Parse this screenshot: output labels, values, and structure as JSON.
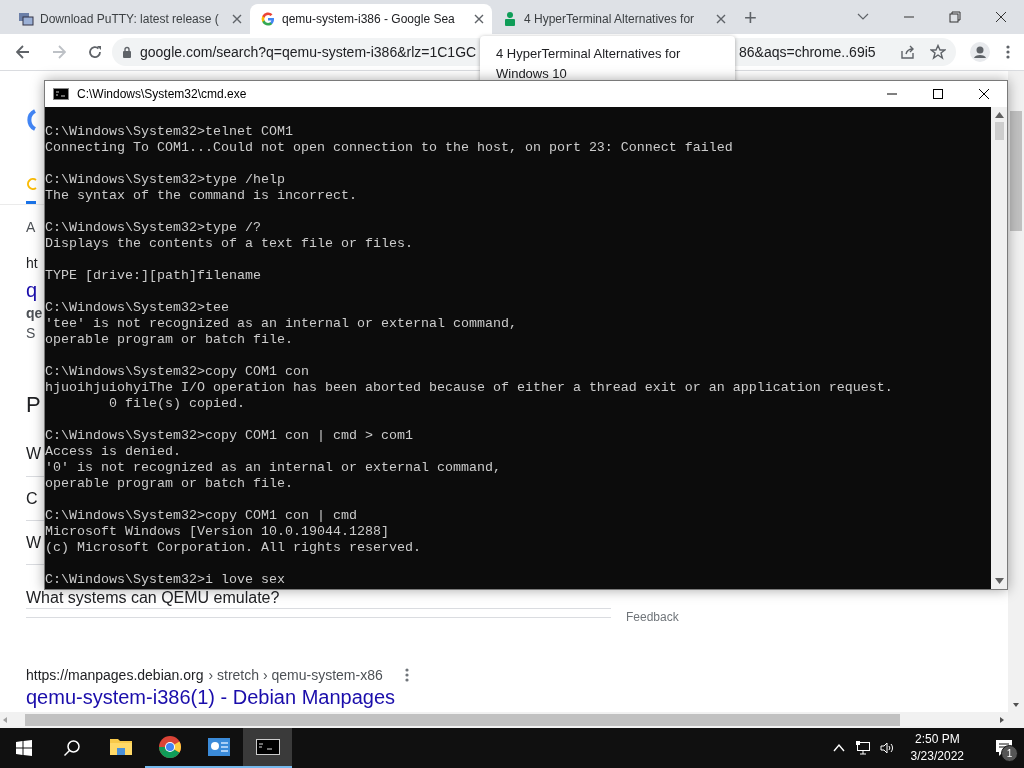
{
  "browser": {
    "tabs": [
      {
        "title": "Download PuTTY: latest release (",
        "kind": "putty",
        "selected": false
      },
      {
        "title": "qemu-system-i386 - Google Sea",
        "kind": "google",
        "selected": true
      },
      {
        "title": "4 HyperTerminal Alternatives for",
        "kind": "person",
        "selected": false
      }
    ],
    "new_tab": "+",
    "address": {
      "url_start": "google.com/search?q=qemu-system-i386&rlz=1C1GC",
      "url_end": "86&aqs=chrome..69i5"
    },
    "tooltip": {
      "lines": [
        "4 HyperTerminal Alternatives for",
        "Windows 10"
      ]
    },
    "page": {
      "results": [
        {
          "kind": "snippet",
          "text": "A"
        },
        {
          "kind": "url",
          "text": "ht"
        },
        {
          "kind": "title",
          "text": "q"
        },
        {
          "kind": "bold",
          "text": "qe"
        },
        {
          "kind": "snippet",
          "text": "S"
        },
        {
          "kind": "heading",
          "text": "P"
        }
      ],
      "questions": [
        "W",
        "C",
        "W",
        "What systems can QEMU emulate?"
      ],
      "feedback": "Feedback",
      "result": {
        "url": "https://manpages.debian.org",
        "path": "› stretch › qemu-system-x86",
        "title": "qemu-system-i386(1) - Debian Manpages"
      }
    }
  },
  "cmd_window": {
    "title": "C:\\Windows\\System32\\cmd.exe",
    "blocks": [
      [
        "C:\\Windows\\System32>telnet COM1",
        "Connecting To COM1...Could not open connection to the host, on port 23: Connect failed"
      ],
      [
        "C:\\Windows\\System32>type /help",
        "The syntax of the command is incorrect."
      ],
      [
        "C:\\Windows\\System32>type /?",
        "Displays the contents of a text file or files."
      ],
      [
        "TYPE [drive:][path]filename"
      ],
      [
        "C:\\Windows\\System32>tee",
        "'tee' is not recognized as an internal or external command,",
        "operable program or batch file."
      ],
      [
        "C:\\Windows\\System32>copy COM1 con",
        "hjuoihjuiohyiThe I/O operation has been aborted because of either a thread exit or an application request.",
        "        0 file(s) copied."
      ],
      [
        "C:\\Windows\\System32>copy COM1 con | cmd > com1",
        "Access is denied.",
        "'0' is not recognized as an internal or external command,",
        "operable program or batch file."
      ],
      [
        "C:\\Windows\\System32>copy COM1 con | cmd",
        "Microsoft Windows [Version 10.0.19044.1288]",
        "(c) Microsoft Corporation. All rights reserved."
      ],
      [
        "C:\\Windows\\System32>i love sex"
      ]
    ]
  },
  "taskbar": {
    "apps": [
      {
        "kind": "explorer",
        "running": false,
        "selected": false
      },
      {
        "kind": "chrome",
        "running": true,
        "selected": false
      },
      {
        "kind": "control",
        "running": true,
        "selected": false
      },
      {
        "kind": "cmd",
        "running": true,
        "selected": true
      }
    ],
    "clock": {
      "time": "2:50 PM",
      "date": "3/23/2022"
    },
    "notifications": "1"
  }
}
